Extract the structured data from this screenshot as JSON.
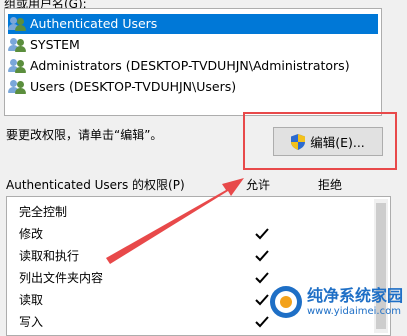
{
  "top_label": "组或用户名(G):",
  "users": [
    {
      "name": "Authenticated Users",
      "icon": "user-group-icon",
      "selected": true
    },
    {
      "name": "SYSTEM",
      "icon": "user-group-icon",
      "selected": false
    },
    {
      "name": "Administrators (DESKTOP-TVDUHJN\\Administrators)",
      "icon": "user-group-icon",
      "selected": false
    },
    {
      "name": "Users (DESKTOP-TVDUHJN\\Users)",
      "icon": "user-group-icon",
      "selected": false
    }
  ],
  "instruction": "要更改权限，请单击“编辑”。",
  "edit_button": {
    "label": "编辑(E)...",
    "icon": "uac-shield-icon"
  },
  "permissions": {
    "header": "Authenticated Users 的权限(P)",
    "allow_label": "允许",
    "deny_label": "拒绝",
    "rows": [
      {
        "name": "完全控制",
        "allow": false,
        "deny": false
      },
      {
        "name": "修改",
        "allow": true,
        "deny": false
      },
      {
        "name": "读取和执行",
        "allow": true,
        "deny": false
      },
      {
        "name": "列出文件夹内容",
        "allow": true,
        "deny": false
      },
      {
        "name": "读取",
        "allow": true,
        "deny": false
      },
      {
        "name": "写入",
        "allow": true,
        "deny": false
      }
    ]
  },
  "colors": {
    "selection": "#0078d7",
    "annotation_red": "#e8494a",
    "watermark": "#1e6fc6"
  },
  "watermark": {
    "title": "纯净系统家园",
    "url": "www.yidaimei.com"
  }
}
